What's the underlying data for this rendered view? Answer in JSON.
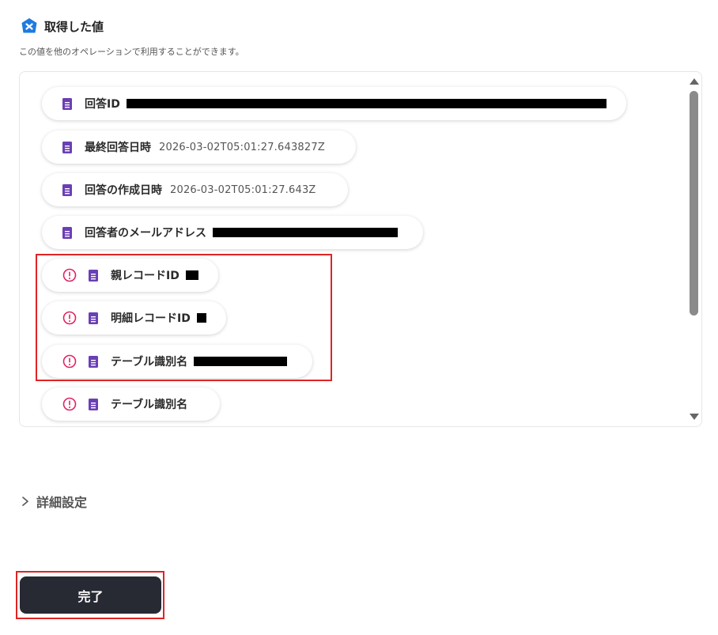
{
  "section": {
    "title": "取得した値",
    "description": "この値を他のオペレーションで利用することができます。"
  },
  "values": [
    {
      "label": "回答ID",
      "value": "",
      "redacted": true,
      "error": false
    },
    {
      "label": "最終回答日時",
      "value": "2026-03-02T05:01:27.643827Z",
      "redacted": false,
      "error": false
    },
    {
      "label": "回答の作成日時",
      "value": "2026-03-02T05:01:27.643Z",
      "redacted": false,
      "error": false
    },
    {
      "label": "回答者のメールアドレス",
      "value": "",
      "redacted": true,
      "error": false
    },
    {
      "label": "親レコードID",
      "value": "",
      "redacted": true,
      "error": true
    },
    {
      "label": "明細レコードID",
      "value": "",
      "redacted": true,
      "error": true
    },
    {
      "label": "テーブル識別名",
      "value": "",
      "redacted": true,
      "error": true
    },
    {
      "label": "テーブル識別名",
      "value": "",
      "redacted": false,
      "error": true
    }
  ],
  "advanced_settings": {
    "label": "詳細設定"
  },
  "done_button": {
    "label": "完了"
  },
  "colors": {
    "brand_blue": "#1f7ae0",
    "form_purple": "#6b3fb5",
    "error_red": "#e0245e",
    "highlight_red": "#e02424",
    "button_dark": "#272a33"
  }
}
